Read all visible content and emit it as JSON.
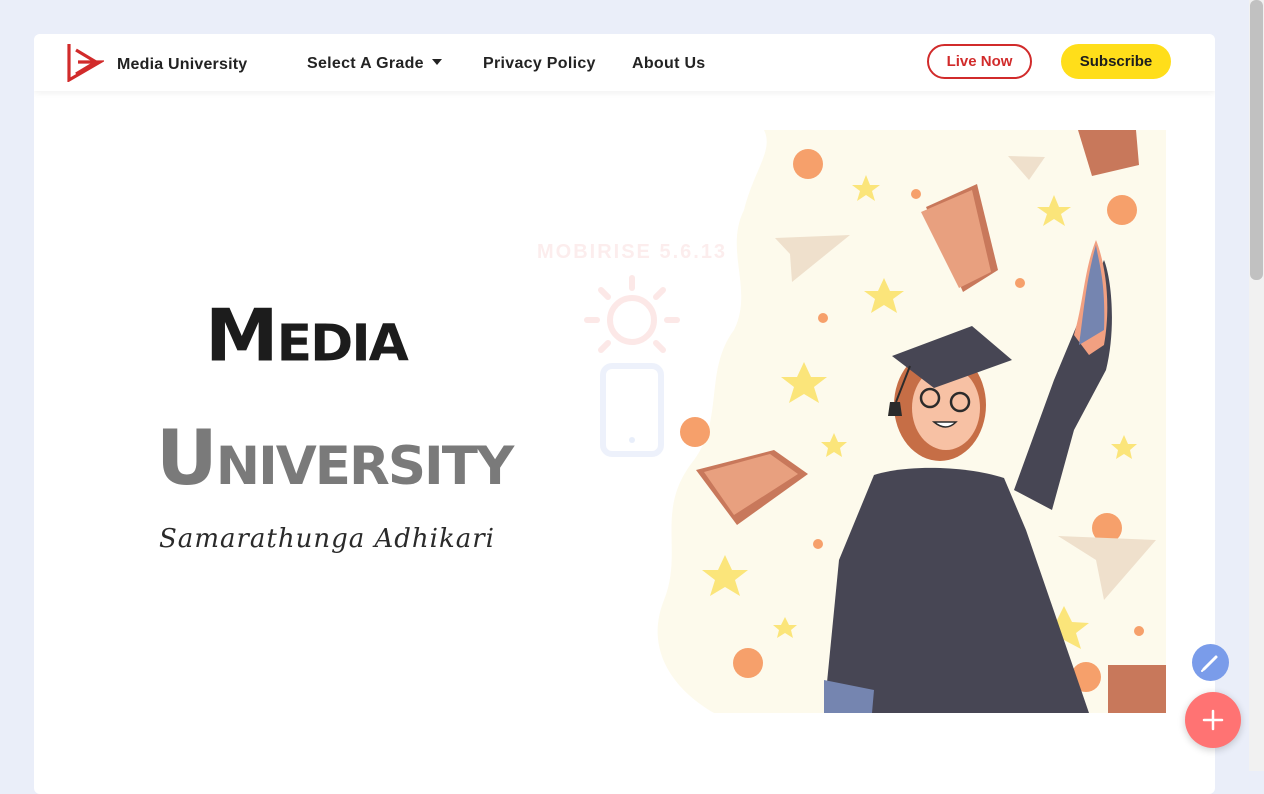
{
  "navbar": {
    "brand_name": "Media University",
    "links": {
      "grade": "Select A Grade",
      "privacy": "Privacy Policy",
      "about": "About Us"
    },
    "live_label": "Live Now",
    "subscribe_label": "Subscribe"
  },
  "hero": {
    "title_line1": "Media",
    "title_line2": "University",
    "signature": "Samarathunga Adhikari",
    "watermark": "MOBIRISE 5.6.13"
  },
  "colors": {
    "brand_red": "#d12b2b",
    "subscribe_yellow": "#ffde1a",
    "fab_blue": "#7a9cea",
    "fab_red": "#ff7373"
  },
  "icons": {
    "brand": "media-university-logo",
    "edit": "pencil-icon",
    "add": "plus-icon"
  }
}
